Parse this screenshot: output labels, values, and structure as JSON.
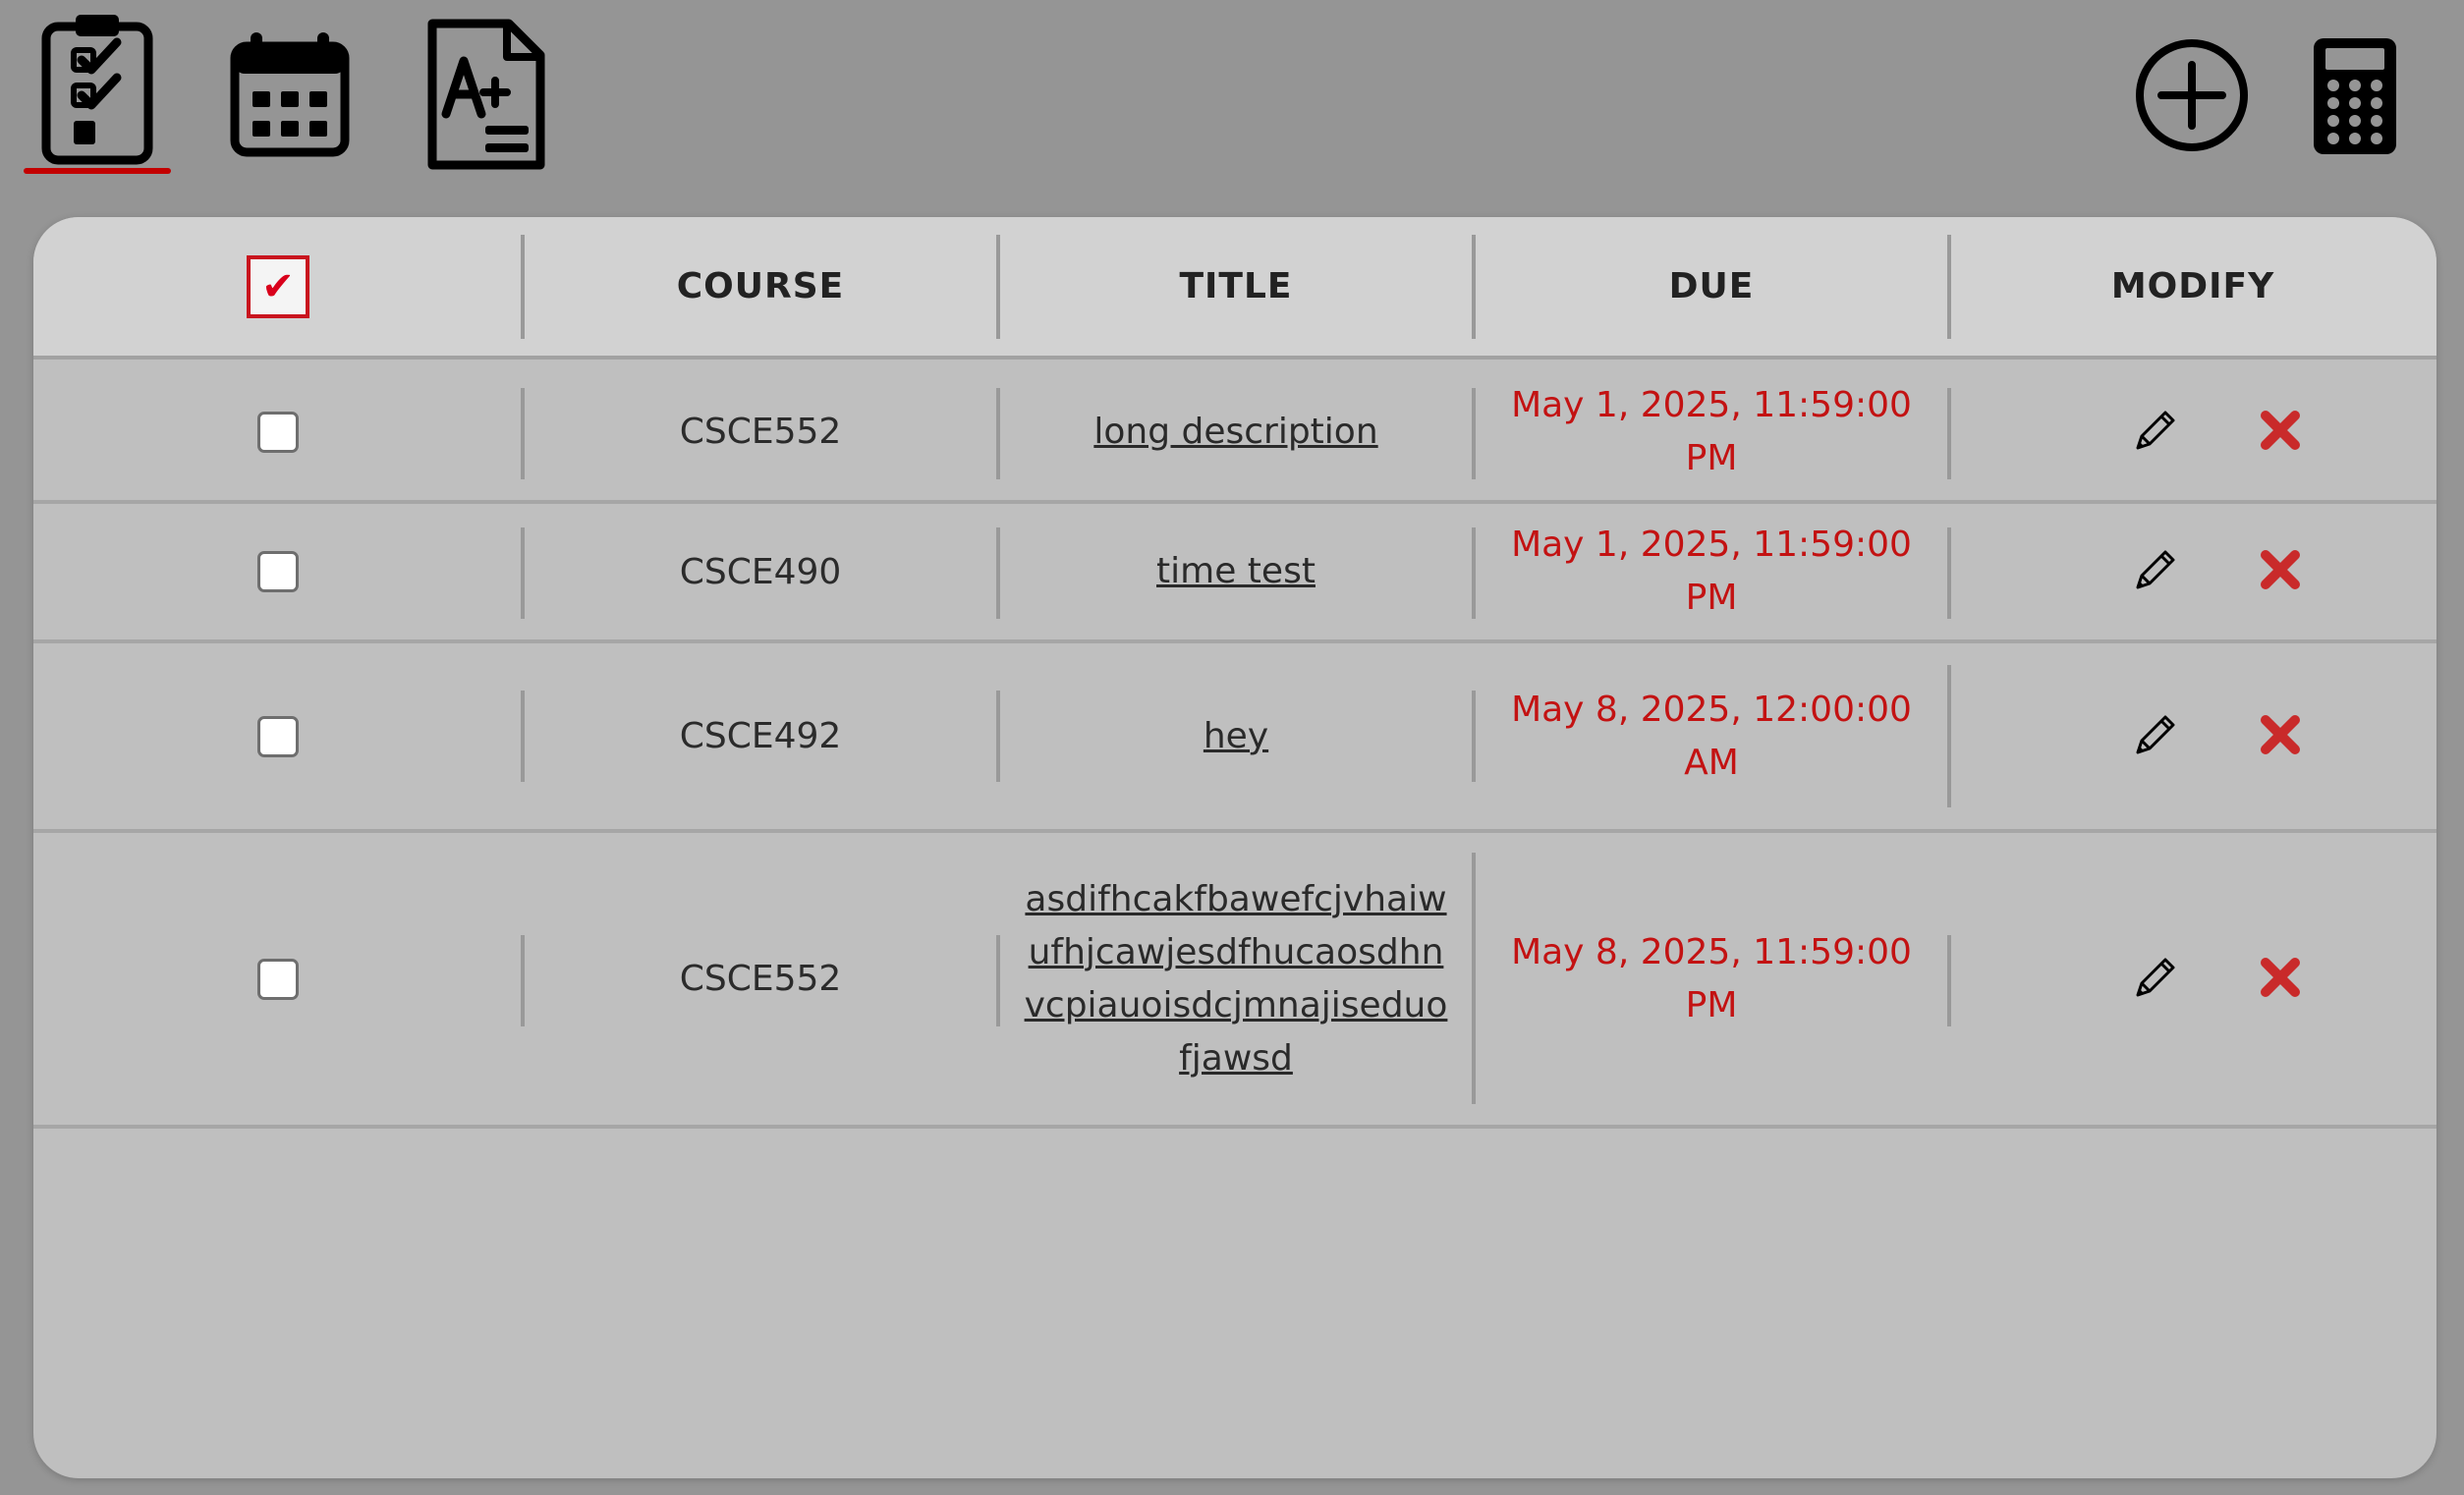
{
  "toolbar": {
    "left_icons": [
      "clipboard-checklist-icon",
      "calendar-icon",
      "grade-document-icon"
    ],
    "right_icons": [
      "add-circle-icon",
      "calculator-icon"
    ],
    "active_tab": "clipboard-checklist-icon",
    "accent_color": "#c30000"
  },
  "table": {
    "header": {
      "select_all_mark": "✔",
      "course": "COURSE",
      "title": "TITLE",
      "due": "DUE",
      "modify": "MODIFY"
    },
    "rows": [
      {
        "course": "CSCE552",
        "title": "long description",
        "due": "May 1, 2025, 11:59:00 PM",
        "checked": false
      },
      {
        "course": "CSCE490",
        "title": "time test",
        "due": "May 1, 2025, 11:59:00 PM",
        "checked": false
      },
      {
        "course": "CSCE492",
        "title": "hey",
        "due": "May 8, 2025, 12:00:00 AM",
        "checked": false
      },
      {
        "course": "CSCE552",
        "title": "asdifhcakfbawefcjvhaiwufhjcawjesdfhucaosdhnvcpiauoisdcjmnajiseduofjawsd",
        "due": "May 8, 2025, 11:59:00 PM",
        "checked": false
      }
    ],
    "due_color": "#c31212",
    "delete_color": "#c92a2a",
    "row_actions": [
      "pencil-icon",
      "delete-x-icon"
    ]
  }
}
